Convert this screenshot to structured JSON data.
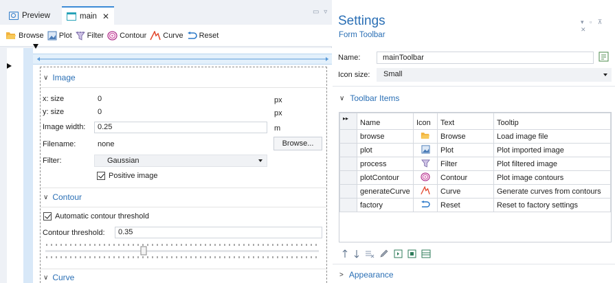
{
  "tabs": [
    {
      "label": "Preview",
      "icon": "preview-icon",
      "active": false
    },
    {
      "label": "main",
      "icon": "form-icon",
      "active": true
    }
  ],
  "toolbar": [
    {
      "label": "Browse",
      "icon": "folder-open-icon"
    },
    {
      "label": "Plot",
      "icon": "plot-icon"
    },
    {
      "label": "Filter",
      "icon": "filter-icon"
    },
    {
      "label": "Contour",
      "icon": "contour-icon"
    },
    {
      "label": "Curve",
      "icon": "curve-icon"
    },
    {
      "label": "Reset",
      "icon": "reset-icon"
    }
  ],
  "form": {
    "image_section": "Image",
    "x_size_label": "x: size",
    "x_size_value": "0",
    "x_size_unit": "px",
    "y_size_label": "y: size",
    "y_size_value": "0",
    "y_size_unit": "px",
    "image_width_label": "Image width:",
    "image_width_value": "0.25",
    "image_width_unit": "m",
    "filename_label": "Filename:",
    "filename_value": "none",
    "browse_button": "Browse...",
    "filter_label": "Filter:",
    "filter_value": "Gaussian",
    "positive_image_label": "Positive image",
    "contour_section": "Contour",
    "auto_contour_label": "Automatic contour threshold",
    "contour_threshold_label": "Contour threshold:",
    "contour_threshold_value": "0.35",
    "curve_section": "Curve"
  },
  "settings": {
    "title": "Settings",
    "subtitle": "Form Toolbar",
    "name_label": "Name:",
    "name_value": "mainToolbar",
    "icon_size_label": "Icon size:",
    "icon_size_value": "Small",
    "toolbar_items_section": "Toolbar Items",
    "columns": [
      "Name",
      "Icon",
      "Text",
      "Tooltip"
    ],
    "rows": [
      {
        "name": "browse",
        "icon": "folder-open-icon",
        "text": "Browse",
        "tooltip": "Load image file"
      },
      {
        "name": "plot",
        "icon": "plot-icon",
        "text": "Plot",
        "tooltip": "Plot imported image"
      },
      {
        "name": "process",
        "icon": "filter-icon",
        "text": "Filter",
        "tooltip": "Plot filtered image"
      },
      {
        "name": "plotContour",
        "icon": "contour-icon",
        "text": "Contour",
        "tooltip": "Plot image contours"
      },
      {
        "name": "generateCurve",
        "icon": "curve-icon",
        "text": "Curve",
        "tooltip": "Generate curves from contours"
      },
      {
        "name": "factory",
        "icon": "reset-icon",
        "text": "Reset",
        "tooltip": "Reset to factory settings"
      }
    ],
    "appearance_section": "Appearance"
  },
  "colors": {
    "accent": "#2a6fb5",
    "ruler": "#d8e8f8"
  }
}
